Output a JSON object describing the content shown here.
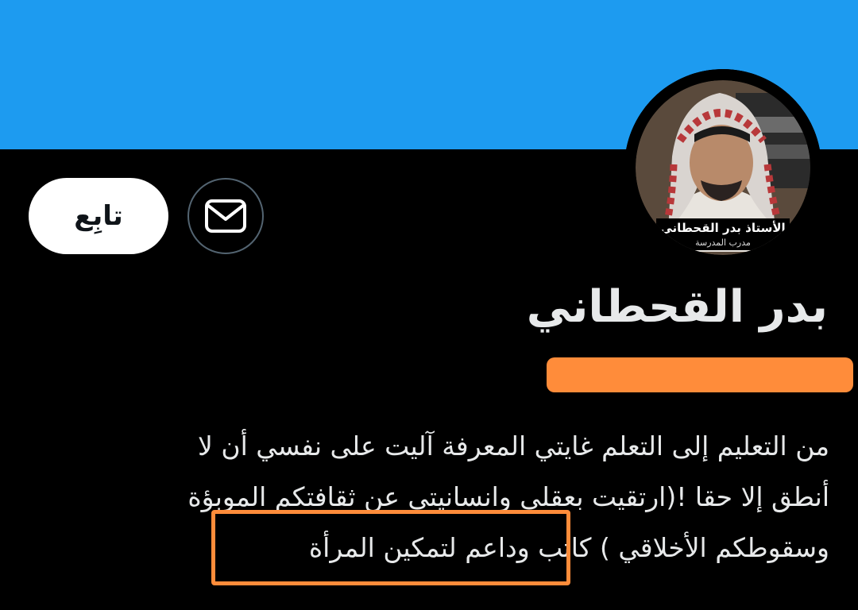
{
  "colors": {
    "banner": "#1D9BF0",
    "background": "#000000",
    "text": "#e7e9ea",
    "annotation": "#FF8C3A"
  },
  "header": {
    "follow_label": "تابِع",
    "message_icon": "envelope-icon"
  },
  "avatar": {
    "caption_line1": "الأستاذ بدر القحطاني",
    "caption_line2": "مدرب المدرسة"
  },
  "profile": {
    "display_name": "بدر القحطاني"
  },
  "bio": {
    "line1": "من التعليم إلى التعلم غايتي المعرفة آليت على نفسي أن لا",
    "line2": "أنطق إلا حقا !(ارتقيت بعقلي وانسانيتي عن ثقافتكم الموبؤة",
    "line3_pre": "وسقوطكم الأخلاقي )",
    "line3_highlight": "كاتب وداعم لتمكين المرأة"
  }
}
